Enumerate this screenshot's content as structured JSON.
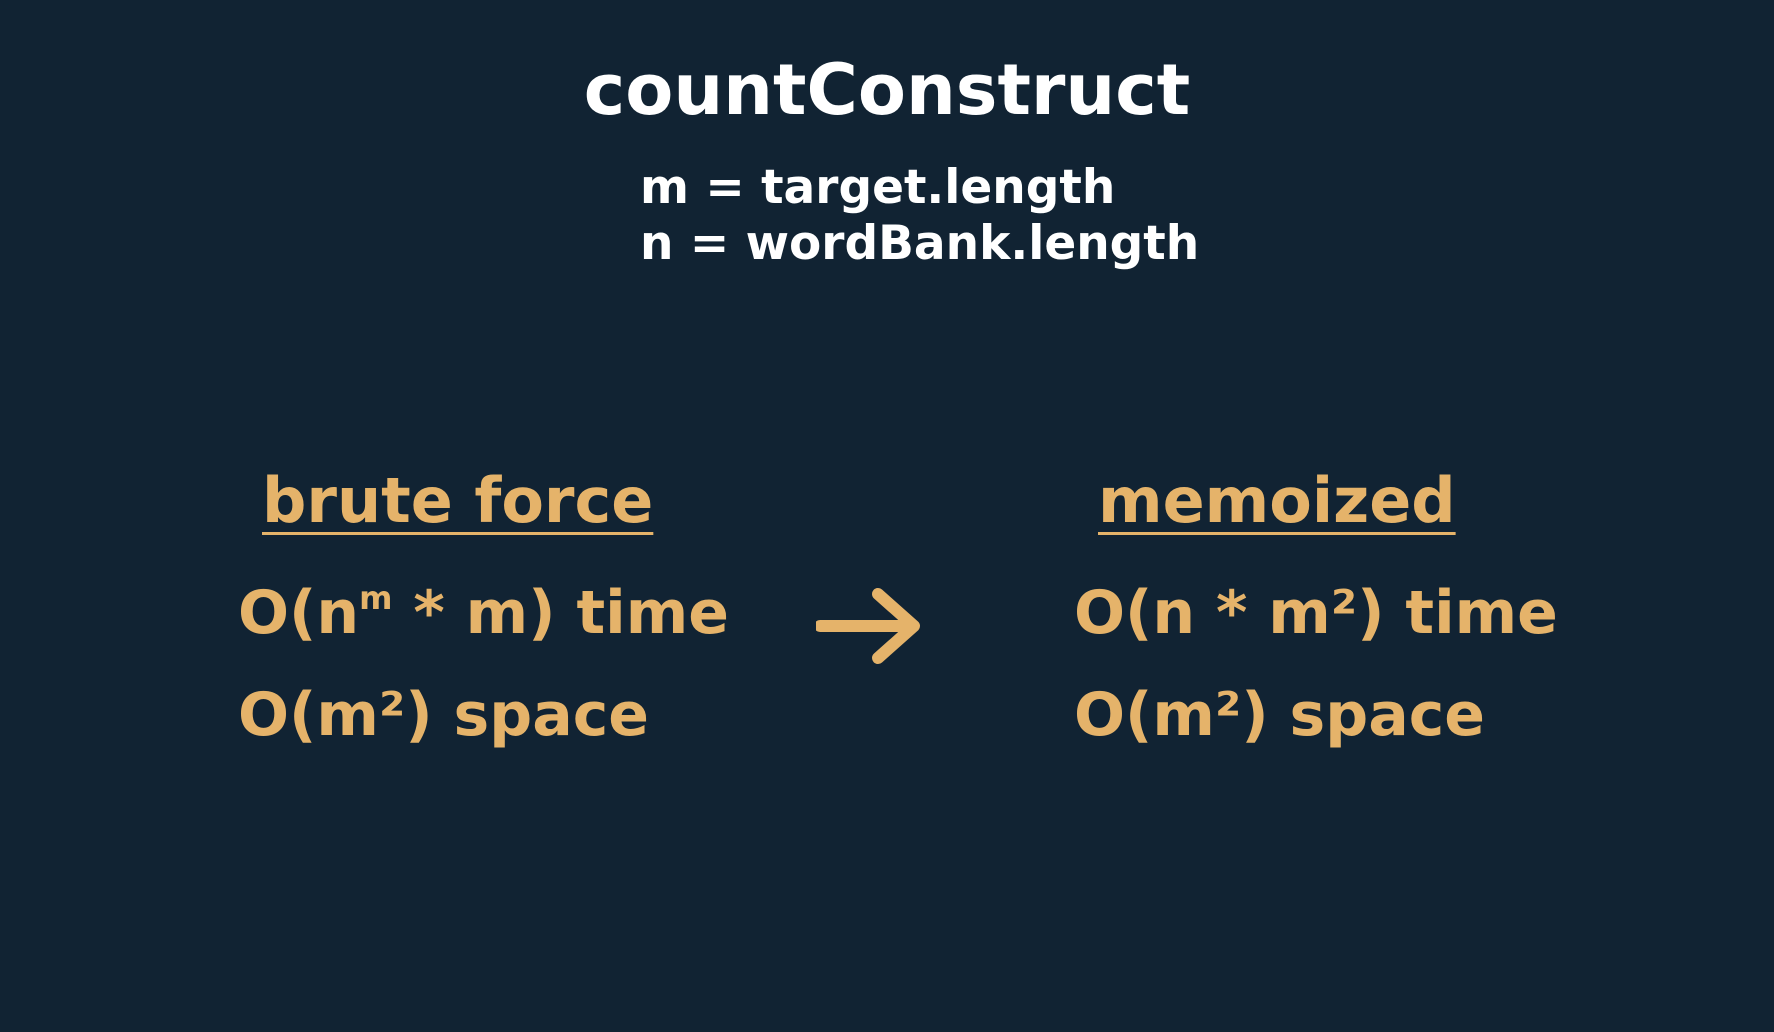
{
  "title": "countConstruct",
  "definitions": [
    "m = target.length",
    "n = wordBank.length"
  ],
  "brute_force": {
    "heading": "brute force",
    "time": {
      "prefix": "O(n",
      "sup": "m",
      "suffix": " * m) time"
    },
    "space": "O(m²) space"
  },
  "memoized": {
    "heading": "memoized",
    "time": "O(n * m²) time",
    "space": "O(m²) space"
  },
  "colors": {
    "background": "#112333",
    "text_white": "#ffffff",
    "accent_gold": "#e5b36a"
  },
  "icons": {
    "arrow": "arrow-right-icon"
  }
}
